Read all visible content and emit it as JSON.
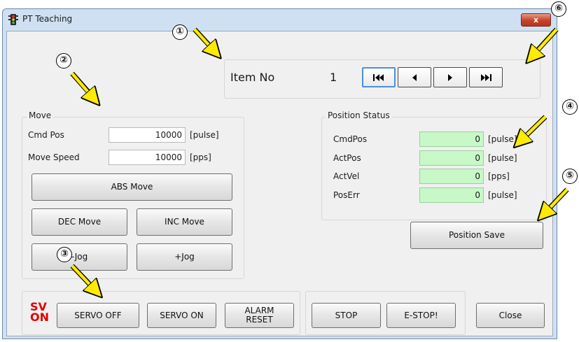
{
  "window": {
    "title": "PT Teaching",
    "close_glyph": "x"
  },
  "item": {
    "label": "Item No",
    "value": "1"
  },
  "nav": {
    "first_icon": "skip-first-icon",
    "prev_icon": "prev-icon",
    "next_icon": "next-icon",
    "last_icon": "skip-last-icon"
  },
  "move": {
    "group_title": "Move",
    "cmd_pos_label": "Cmd Pos",
    "cmd_pos_value": "10000",
    "cmd_pos_unit": "[pulse]",
    "speed_label": "Move Speed",
    "speed_value": "10000",
    "speed_unit": "[pps]",
    "abs_move": "ABS Move",
    "dec_move": "DEC Move",
    "inc_move": "INC Move",
    "jog_minus": "-Jog",
    "jog_plus": "+Jog"
  },
  "position_status": {
    "group_title": "Position Status",
    "rows": [
      {
        "label": "CmdPos",
        "value": "0",
        "unit": "[pulse]"
      },
      {
        "label": "ActPos",
        "value": "0",
        "unit": "[pulse]"
      },
      {
        "label": "ActVel",
        "value": "0",
        "unit": "[pps]"
      },
      {
        "label": "PosErr",
        "value": "0",
        "unit": "[pulse]"
      }
    ],
    "save_button": "Position Save"
  },
  "servo": {
    "indicator_line1": "SV",
    "indicator_line2": "ON",
    "servo_off": "SERVO OFF",
    "servo_on": "SERVO ON",
    "alarm_reset_line1": "ALARM",
    "alarm_reset_line2": "RESET"
  },
  "stop": {
    "stop": "STOP",
    "estop": "E-STOP!"
  },
  "close_button": "Close",
  "annotations": {
    "n1": "①",
    "n2": "②",
    "n3": "③",
    "n4": "④",
    "n5": "⑤",
    "n6": "⑥"
  },
  "colors": {
    "status_field": "#c8f7c8",
    "annotation_arrow": "#ffeb00",
    "sv_on": "#e00000"
  }
}
